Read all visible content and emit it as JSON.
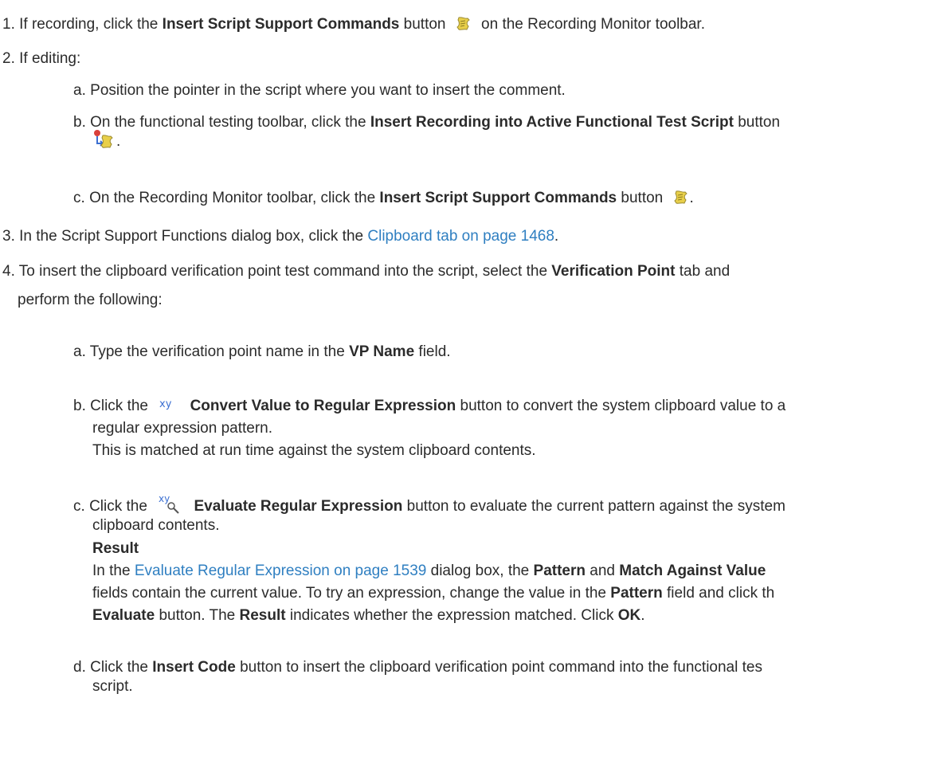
{
  "step1": {
    "num": "1.",
    "pre": "If recording, click the",
    "bold": "Insert Script Support Commands",
    "mid": "button",
    "icon": "script-support-icon",
    "post": "on the Recording Monitor toolbar."
  },
  "step2": {
    "num": "2.",
    "text": "If editing:",
    "a": {
      "letter": "a.",
      "text": "Position the pointer in the script where you want to insert the comment."
    },
    "b": {
      "letter": "b.",
      "pre": "On the functional testing toolbar, click the",
      "bold": "Insert Recording into Active Functional Test Script",
      "post": "button",
      "icon": "insert-recording-icon",
      "end": "."
    },
    "c": {
      "letter": "c.",
      "pre": "On the Recording Monitor toolbar, click the",
      "bold": "Insert Script Support Commands",
      "post": "button",
      "icon": "script-support-icon",
      "end": "."
    }
  },
  "step3": {
    "num": "3.",
    "pre": "In the Script Support Functions dialog box, click the",
    "link": "Clipboard tab on page 1468",
    "end": "."
  },
  "step4": {
    "num": "4.",
    "pre": "To insert the clipboard verification point test command into the script, select the",
    "bold": "Verification Point",
    "post": "tab and",
    "line2": "perform the following:",
    "a": {
      "letter": "a.",
      "pre": "Type the verification point name in the",
      "bold": "VP Name",
      "post": "field."
    },
    "b": {
      "letter": "b.",
      "pre": "Click the",
      "icon": "convert-regex-icon",
      "icon_text": "xy",
      "bold": "Convert Value to Regular Expression",
      "post": "button to convert the system clipboard value to a",
      "line2": "regular expression pattern.",
      "line3": "This is matched at run time against the system clipboard contents."
    },
    "c": {
      "letter": "c.",
      "pre": "Click the",
      "icon": "evaluate-regex-icon",
      "icon_text": "xy",
      "bold": "Evaluate Regular Expression",
      "post": "button to evaluate the current pattern against the system",
      "line2": "clipboard contents.",
      "result_heading": "Result",
      "r1_pre": "In the",
      "r1_link": "Evaluate Regular Expression on page 1539",
      "r1_mid": "dialog box, the",
      "r1_bold1": "Pattern",
      "r1_and": "and",
      "r1_bold2": "Match Against Value",
      "r2_pre": "fields contain the current value. To try an expression, change the value in the",
      "r2_bold": "Pattern",
      "r2_post": "field and click th",
      "r3_bold1": "Evaluate",
      "r3_mid": "button. The",
      "r3_bold2": "Result",
      "r3_mid2": "indicates whether the expression matched. Click",
      "r3_bold3": "OK",
      "r3_end": "."
    },
    "d": {
      "letter": "d.",
      "pre": "Click the",
      "bold": "Insert Code",
      "post": "button to insert the clipboard verification point command into the functional tes",
      "line2": "script."
    }
  },
  "colors": {
    "text": "#2b2b2b",
    "link": "#2f7fc1",
    "icon_blue": "#3b6fd1"
  }
}
